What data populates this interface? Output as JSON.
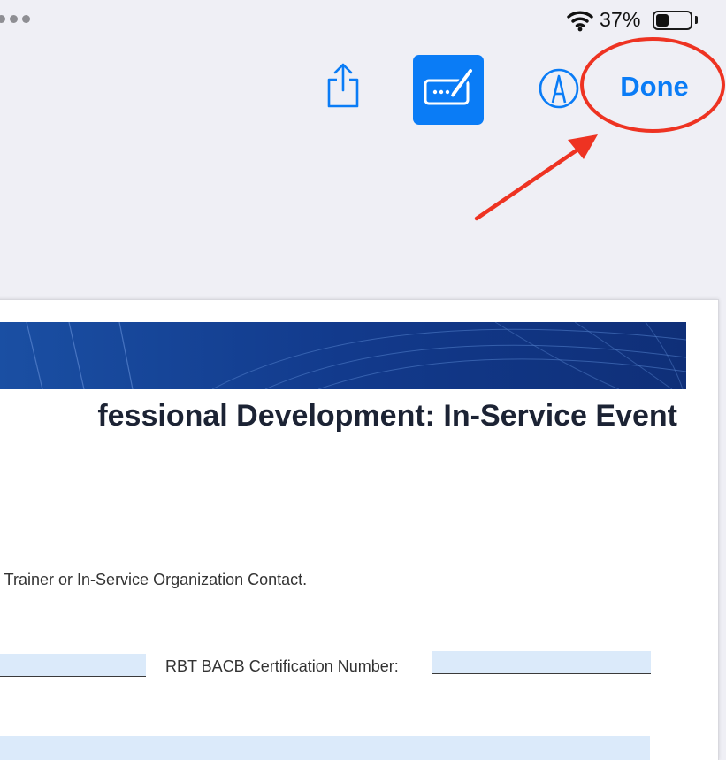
{
  "status_bar": {
    "battery_percent": "37%",
    "wifi_icon": "wifi-icon",
    "battery_icon": "battery-icon",
    "multitasking_icon": "three-dots-icon"
  },
  "toolbar": {
    "share_icon": "share-icon",
    "fill_form_icon": "form-fill-icon",
    "markup_icon": "markup-pen-icon",
    "done_label": "Done",
    "accent_color": "#0a7cf6"
  },
  "annotation": {
    "color": "#ee3322",
    "circle_target": "Done",
    "arrow_icon": "arrow-icon"
  },
  "document": {
    "title": "fessional Development: In-Service Event",
    "instruction": "e Trainer or In-Service Organization Contact.",
    "cert_label": "RBT BACB Certification Number:",
    "banner_color": "#12398b"
  }
}
